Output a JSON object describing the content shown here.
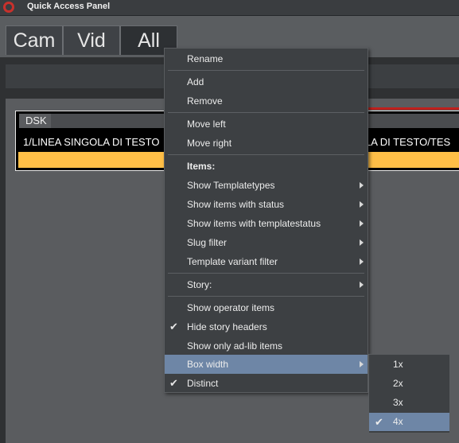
{
  "window": {
    "title": "Quick Access Panel"
  },
  "tabs": [
    {
      "label": "Cam"
    },
    {
      "label": "Vid"
    },
    {
      "label": "All",
      "active": true
    }
  ],
  "item": {
    "header": "DSK",
    "left_text": "1/LINEA SINGOLA DI TESTO",
    "right_text": "LA DI TESTO/TES",
    "status_color": "#ffbf47",
    "border_color": "#c0201c"
  },
  "context_menu": {
    "items": [
      {
        "label": "Rename"
      },
      {
        "label": "Add"
      },
      {
        "label": "Remove"
      },
      {
        "label": "Move left"
      },
      {
        "label": "Move right"
      },
      {
        "label": "Items:"
      },
      {
        "label": "Show Templatetypes",
        "submenu": true
      },
      {
        "label": "Show items with status",
        "submenu": true
      },
      {
        "label": "Show items with templatestatus",
        "submenu": true
      },
      {
        "label": "Slug filter",
        "submenu": true
      },
      {
        "label": "Template variant filter",
        "submenu": true
      },
      {
        "label": "Story:",
        "submenu": true
      },
      {
        "label": "Show operator items"
      },
      {
        "label": "Hide story headers",
        "checked": true
      },
      {
        "label": "Show only ad-lib items"
      },
      {
        "label": "Box width",
        "submenu": true,
        "highlighted": true
      },
      {
        "label": "Distinct",
        "checked": true
      }
    ]
  },
  "box_width_submenu": {
    "options": [
      {
        "label": "1x"
      },
      {
        "label": "2x"
      },
      {
        "label": "3x"
      },
      {
        "label": "4x",
        "checked": true,
        "highlighted": true
      }
    ]
  },
  "glyphs": {
    "check": "✔"
  },
  "colors": {
    "highlight": "#6e86a6",
    "accent_orange": "#ffbf47",
    "logo_red": "#c8312c"
  }
}
